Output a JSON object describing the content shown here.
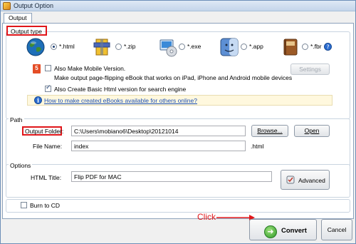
{
  "window": {
    "title": "Output Option"
  },
  "tabs": [
    {
      "label": "Output"
    }
  ],
  "output_type": {
    "group_label": "Output type",
    "formats": [
      {
        "icon": "globe-icon",
        "label": "*.html",
        "selected": true
      },
      {
        "icon": "zip-archive-icon",
        "label": "*.zip",
        "selected": false
      },
      {
        "icon": "exe-cd-icon",
        "label": "*.exe",
        "selected": false
      },
      {
        "icon": "mac-finder-icon",
        "label": "*.app",
        "selected": false
      },
      {
        "icon": "book-icon",
        "label": "*.fbr",
        "selected": false
      }
    ],
    "mobile": {
      "badge": "5",
      "checkbox_label": "Also Make Mobile Version.",
      "checked": false,
      "description": "Make output page-flipping eBook that works on iPad, iPhone and Android mobile devices",
      "settings_label": "Settings"
    },
    "basic_html": {
      "label": "Also Create Basic Html version for search engine",
      "checked": true
    },
    "help_link": "How to make created eBooks available for others online?"
  },
  "path": {
    "group_label": "Path",
    "output_folder_label": "Output Folder:",
    "output_folder_value": "C:\\Users\\mobiano6\\Desktop\\20121014",
    "browse_label": "Browse...",
    "open_label": "Open",
    "file_name_label": "File Name:",
    "file_name_value": "index",
    "file_ext": ".html"
  },
  "options": {
    "group_label": "Options",
    "html_title_label": "HTML Title:",
    "html_title_value": "Flip PDF for MAC",
    "advanced_label": "Advanced"
  },
  "burn": {
    "label": "Burn to CD",
    "checked": false
  },
  "annotation": {
    "text": "Click",
    "color": "#e0161a"
  },
  "footer": {
    "convert_label": "Convert",
    "cancel_label": "Cancel"
  },
  "colors": {
    "accent": "#1d3f73",
    "highlight": "#e0161a",
    "link": "#1a4fb8",
    "title_bar": "#c4d5ea"
  }
}
